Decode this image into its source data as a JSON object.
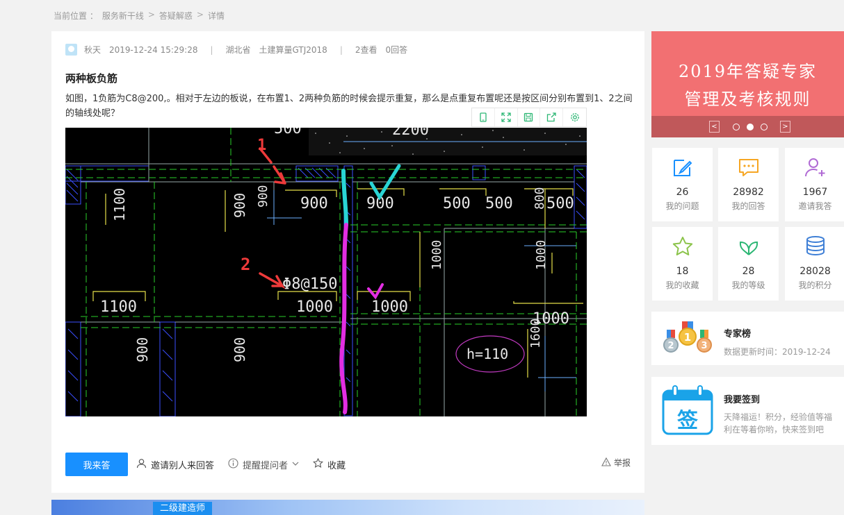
{
  "breadcrumb": {
    "label": "当前位置 ：",
    "items": [
      "服务新干线",
      "答疑解惑",
      "详情"
    ],
    "sep": ">"
  },
  "question": {
    "user": "秋天",
    "time": "2019-12-24 15:29:28",
    "region": "湖北省",
    "software": "土建算量GTJ2018",
    "views": "2查看",
    "answers": "0回答",
    "title": "两种板负筋",
    "body": "如图，1负筋为C8@200,。相对于左边的板说，在布置1、2两种负筋的时候会提示重复，那么是点重复布置呢还是按区间分别布置到1、2之间的轴线处呢？"
  },
  "image_tools": {
    "icons": [
      "phone-view-icon",
      "fullscreen-icon",
      "save-icon",
      "share-icon",
      "settings-icon"
    ]
  },
  "cad": {
    "labels": [
      "500",
      "2200",
      "1100",
      "900",
      "900",
      "900",
      "900",
      "500",
      "500",
      "800",
      "500",
      "Φ8@150",
      "1000",
      "1000",
      "1100",
      "1000",
      "1000",
      "1000",
      "1600",
      "900",
      "900",
      "h=110",
      "1",
      "2"
    ]
  },
  "actions": {
    "answer": "我来答",
    "invite": "邀请别人来回答",
    "remind": "提醒提问者",
    "favorite": "收藏",
    "report": "举报"
  },
  "bottom_banner": {
    "tag": "二级建造师"
  },
  "promo": {
    "line1": "2019年答疑专家",
    "line2": "管理及考核规则",
    "prev": "<",
    "next": ">"
  },
  "stats": [
    {
      "num": "26",
      "label": "我的问题",
      "icon": "edit-icon",
      "color": "#1890ff"
    },
    {
      "num": "28982",
      "label": "我的回答",
      "icon": "chat-icon",
      "color": "#f6a623"
    },
    {
      "num": "1967",
      "label": "邀请我答",
      "icon": "add-user-icon",
      "color": "#b06ad4"
    },
    {
      "num": "18",
      "label": "我的收藏",
      "icon": "star-icon",
      "color": "#8bc34a"
    },
    {
      "num": "28",
      "label": "我的等级",
      "icon": "leaf-icon",
      "color": "#2bb673"
    },
    {
      "num": "28028",
      "label": "我的积分",
      "icon": "coins-icon",
      "color": "#3e7fd6"
    }
  ],
  "ranking": {
    "title": "专家榜",
    "updated": "数据更新时间：2019-12-24"
  },
  "signin": {
    "title": "我要签到",
    "desc": "天降福运！积分，经验值等福利在等着你哟，快来签到吧",
    "badge": "签"
  }
}
